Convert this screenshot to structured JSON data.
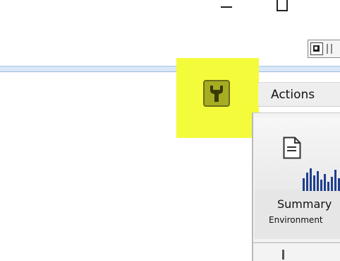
{
  "window": {
    "controls": [
      "minimize-icon",
      "maximize-icon"
    ]
  },
  "toolbar": {
    "icons": [
      "restore-icon"
    ]
  },
  "highlight": {
    "color": "#f4fb3a"
  },
  "wrench_button": {
    "icon": "wrench-icon",
    "color": "#a6ad22"
  },
  "actions": {
    "label": "Actions"
  },
  "tile": {
    "icons": [
      "document-icon",
      "bar-chart-icon"
    ],
    "title": "Summary",
    "subtitle": "Environment"
  }
}
